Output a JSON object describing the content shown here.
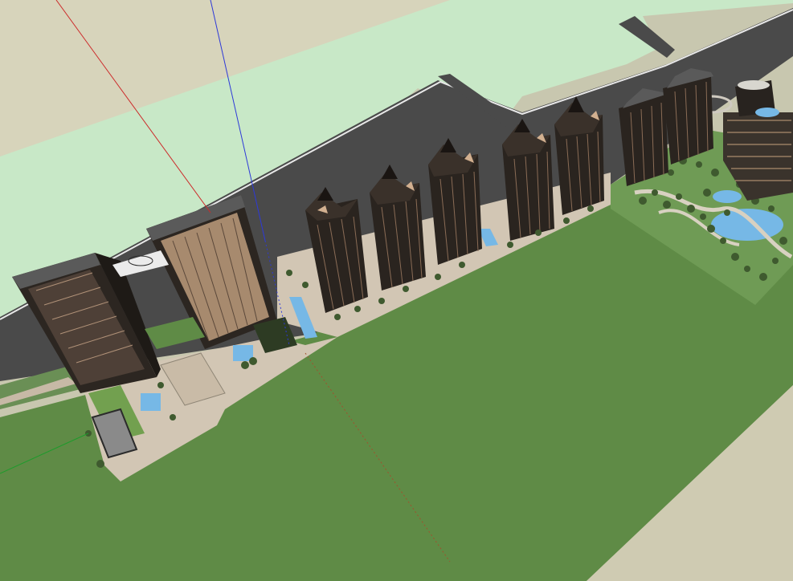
{
  "app": {
    "title": "",
    "status": ""
  },
  "viewport": {
    "description_colors": {
      "sky": "#c8c7af",
      "sky_light": "#d8d6bd",
      "ground_light": "#c9e8c9",
      "ground_dark": "#5f8b46",
      "road": "#4b4b4b",
      "road_edge": "#d9d9d9",
      "sidewalk": "#d2c6b4",
      "tower_dark": "#2a241f",
      "tower_light": "#c7a17d",
      "glass": "#bfa28a",
      "water": "#76b8e6",
      "tree": "#4e6b3a",
      "axis_red": "#cc2a2a",
      "axis_blue": "#2d39d8",
      "axis_green": "#1e9b2c"
    }
  },
  "scene": {
    "towers_count": 7,
    "office_towers_count": 2
  }
}
